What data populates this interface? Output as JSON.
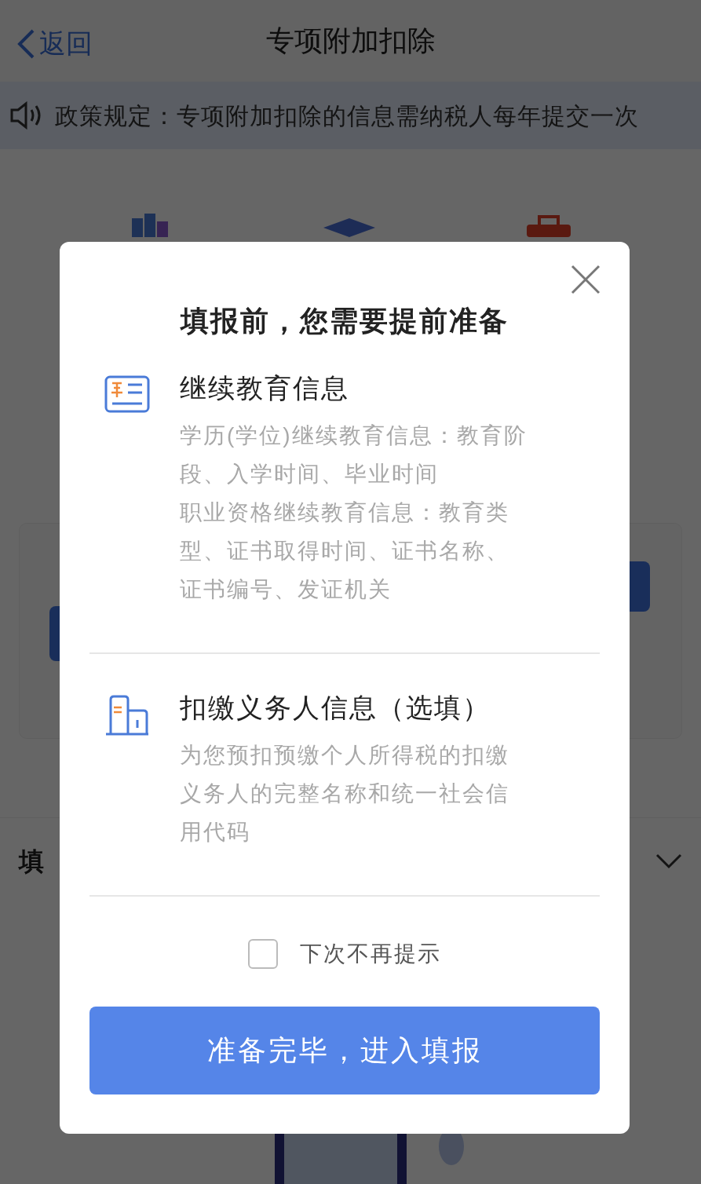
{
  "nav": {
    "back": "返回",
    "title": "专项附加扣除"
  },
  "notice": {
    "text": "政策规定：专项附加扣除的信息需纳税人每年提交一次"
  },
  "background_row": {
    "label": "填"
  },
  "dialog": {
    "title": "填报前，您需要提前准备",
    "sections": [
      {
        "kind": "education",
        "title": "继续教育信息",
        "lines": [
          "学历(学位)继续教育信息：教育阶段、入学时间、毕业时间",
          "职业资格继续教育信息：教育类型、证书取得时间、证书名称、证书编号、发证机关"
        ]
      },
      {
        "kind": "employer",
        "title": "扣缴义务人信息（选填）",
        "lines": [
          "为您预扣预缴个人所得税的扣缴义务人的完整名称和统一社会信用代码"
        ]
      }
    ],
    "dont_show_again": {
      "label": "下次不再提示",
      "checked": false
    },
    "confirm_button": "准备完毕，进入填报"
  }
}
